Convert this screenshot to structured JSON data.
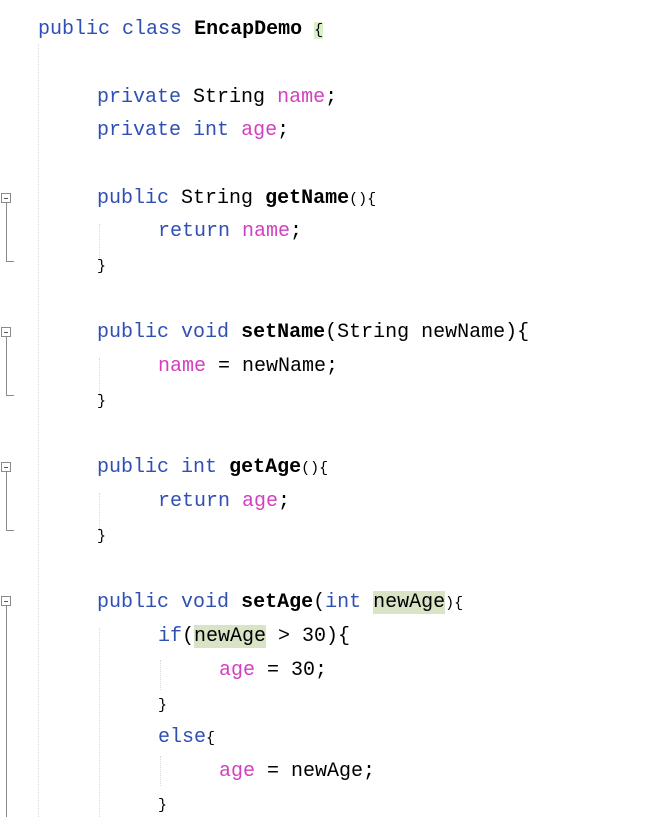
{
  "code": {
    "class_decl": {
      "kw_public": "public",
      "kw_class": "class",
      "class_name": "EncapDemo",
      "brace": "{"
    },
    "field_name": {
      "kw_private": "private",
      "type": "String",
      "name": "name",
      "semi": ";"
    },
    "field_age": {
      "kw_private": "private",
      "type": "int",
      "name": "age",
      "semi": ";"
    },
    "get_name": {
      "kw_public": "public",
      "type": "String",
      "method": "getName",
      "params": "(){",
      "kw_return": "return",
      "ret_field": "name",
      "semi": ";",
      "close": "}"
    },
    "set_name": {
      "kw_public": "public",
      "kw_void": "void",
      "method": "setName",
      "params": "(String newName){",
      "field": "name",
      "assign": " = newName;",
      "close": "}"
    },
    "get_age": {
      "kw_public": "public",
      "type": "int",
      "method": "getAge",
      "params": "(){",
      "kw_return": "return",
      "ret_field": "age",
      "semi": ";",
      "close": "}"
    },
    "set_age": {
      "kw_public": "public",
      "kw_void": "void",
      "method": "setAge",
      "paren_open": "(",
      "kw_int": "int",
      "param": "newAge",
      "paren_close": "){",
      "kw_if": "if",
      "if_open": "(",
      "if_param": "newAge",
      "if_cond": " > 30){",
      "if_field": "age",
      "if_assign": " = 30;",
      "if_close": "}",
      "kw_else": "else",
      "else_open": "{",
      "else_field": "age",
      "else_assign": " = newAge;",
      "else_close": "}"
    }
  },
  "colors": {
    "keyword": "#2f4fb5",
    "field": "#d43fbf",
    "plain": "#000000",
    "brace_highlight": "#d9f0c8",
    "occurrence_highlight": "#d9e4c6"
  },
  "gutter": {
    "fold_icon": "collapse-minus-icon"
  }
}
